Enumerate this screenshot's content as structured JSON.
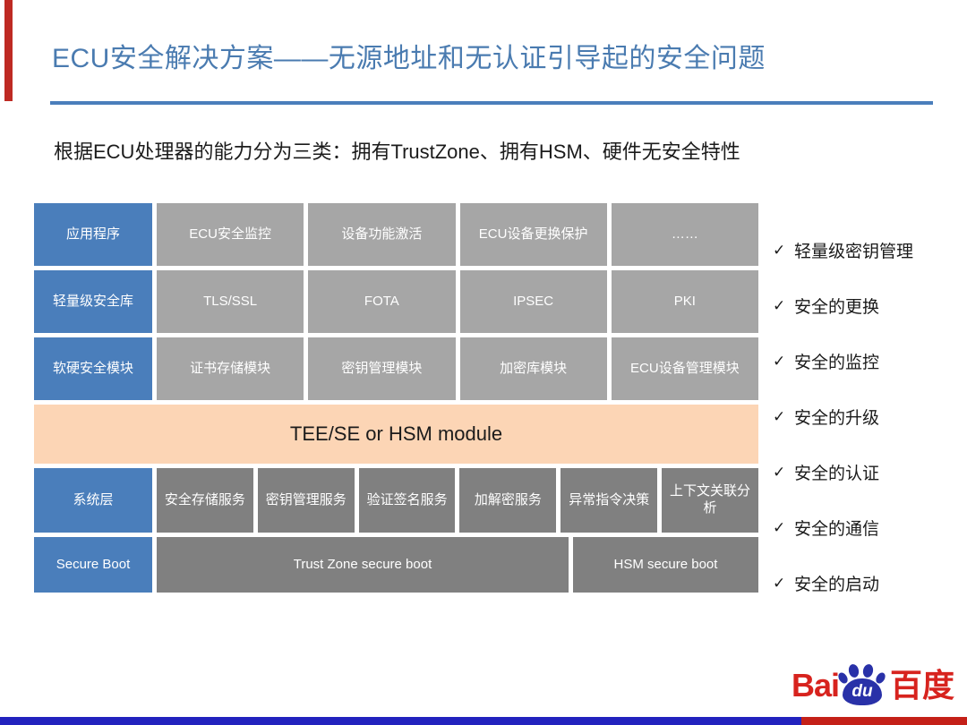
{
  "slide": {
    "title": "ECU安全解决方案——无源地址和无认证引导起的安全问题",
    "subtitle": "根据ECU处理器的能力分为三类：拥有TrustZone、拥有HSM、硬件无安全特性"
  },
  "colors": {
    "title_blue": "#4A7BB0",
    "rule_blue": "#4A7EBB",
    "left_accent_red": "#BE2A23",
    "cell_blue": "#4A7EBB",
    "cell_gray": "#A6A6A6",
    "cell_dark_gray": "#808080",
    "tee_peach": "#FCD5B5",
    "bottom_bar_blue": "#2222BE",
    "bottom_bar_red": "#C42018",
    "logo_red": "#D7231E",
    "logo_blue": "#2931A8"
  },
  "stack": {
    "row_application": {
      "label": "应用程序",
      "cells": [
        "ECU安全监控",
        "设备功能激活",
        "ECU设备更换保护",
        "……"
      ]
    },
    "row_lightweight_lib": {
      "label": "轻量级安全库",
      "cells": [
        "TLS/SSL",
        "FOTA",
        "IPSEC",
        "PKI"
      ]
    },
    "row_security_module": {
      "label": "软硬安全模块",
      "cells": [
        "证书存储模块",
        "密钥管理模块",
        "加密库模块",
        "ECU设备管理模块"
      ]
    },
    "tee_band": "TEE/SE or HSM module",
    "row_system": {
      "label": "系统层",
      "cells": [
        "安全存储服务",
        "密钥管理服务",
        "验证签名服务",
        "加解密服务",
        "异常指令决策",
        "上下文关联分析"
      ]
    },
    "row_secure_boot": {
      "label": "Secure Boot",
      "cells": [
        "Trust Zone secure boot",
        "HSM  secure boot"
      ]
    }
  },
  "checklist": {
    "mark": "✓",
    "items": [
      "轻量级密钥管理",
      "安全的更换",
      "安全的监控",
      "安全的升级",
      "安全的认证",
      "安全的通信",
      "安全的启动"
    ]
  },
  "logo": {
    "bai": "Bai",
    "du": "du",
    "cn": "百度"
  }
}
